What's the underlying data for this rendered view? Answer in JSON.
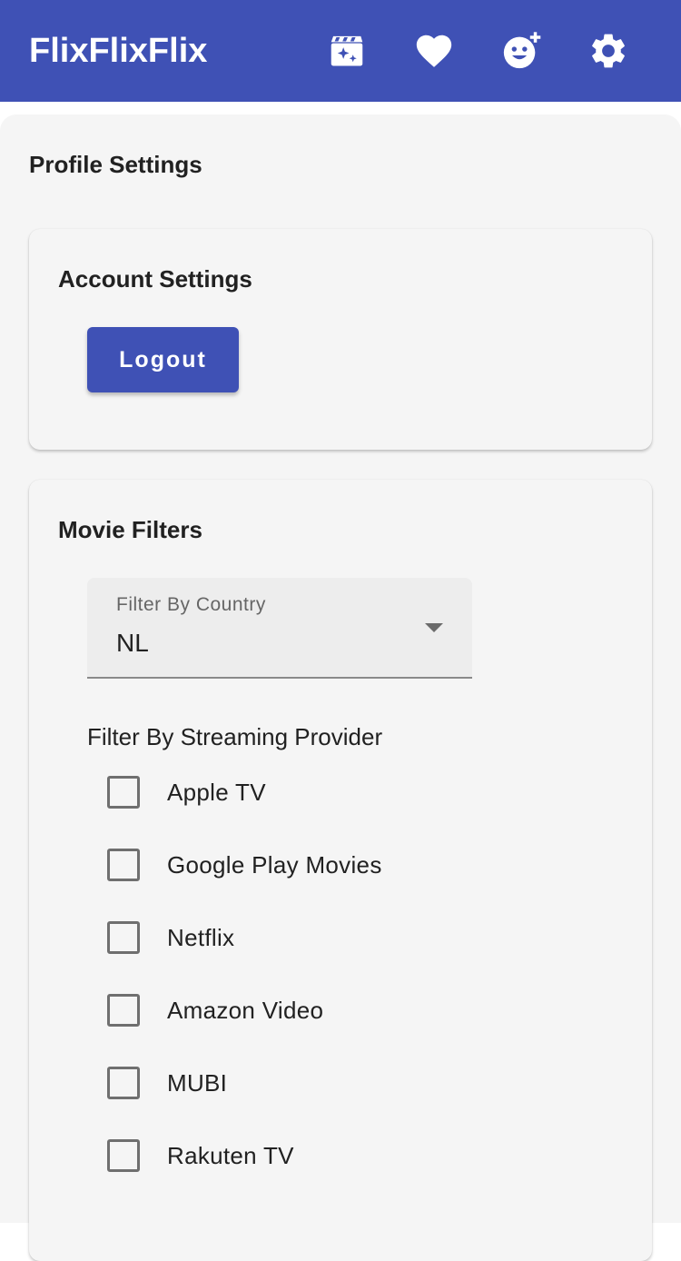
{
  "appbar": {
    "title": "FlixFlixFlix",
    "background_color": "#3f51b5",
    "icons": [
      {
        "name": "movie-sparkle-icon",
        "label": "discover"
      },
      {
        "name": "heart-icon",
        "label": "favorites"
      },
      {
        "name": "add-reaction-icon",
        "label": "add-friend"
      },
      {
        "name": "gear-icon",
        "label": "settings"
      }
    ]
  },
  "page": {
    "title": "Profile Settings"
  },
  "account_card": {
    "title": "Account Settings",
    "logout_label": "Logout"
  },
  "filters_card": {
    "title": "Movie Filters",
    "country_select": {
      "label": "Filter By Country",
      "value": "NL"
    },
    "providers_heading": "Filter By Streaming Provider",
    "providers": [
      {
        "label": "Apple TV",
        "checked": false
      },
      {
        "label": "Google Play Movies",
        "checked": false
      },
      {
        "label": "Netflix",
        "checked": false
      },
      {
        "label": "Amazon Video",
        "checked": false
      },
      {
        "label": "MUBI",
        "checked": false
      },
      {
        "label": "Rakuten TV",
        "checked": false
      }
    ]
  },
  "colors": {
    "primary": "#3f51b5",
    "surface": "#f5f5f5",
    "text": "#212121"
  }
}
